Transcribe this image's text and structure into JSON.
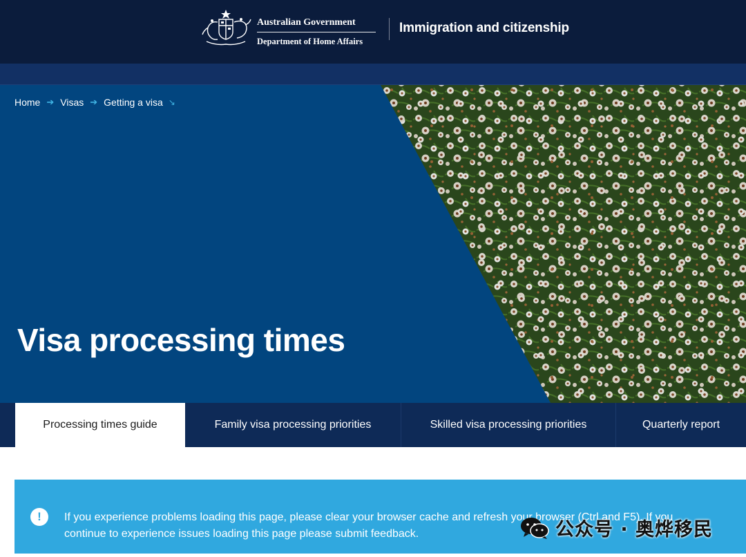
{
  "header": {
    "gov_name": "Australian Government",
    "department": "Department of Home Affairs",
    "site_title": "Immigration and citizenship"
  },
  "breadcrumb": {
    "items": [
      "Home",
      "Visas",
      "Getting a visa"
    ]
  },
  "hero": {
    "title": "Visa processing times"
  },
  "tabs": [
    {
      "label": "Processing times guide",
      "active": true
    },
    {
      "label": "Family visa processing priorities",
      "active": false
    },
    {
      "label": "Skilled visa processing priorities",
      "active": false
    },
    {
      "label": "Quarterly report",
      "active": false
    }
  ],
  "alert": {
    "text": "If you experience problems loading this page, please clear your browser cache and refresh your browser (Ctrl and F5). If you continue to experience issues loading this page please submit feedback."
  },
  "watermark": {
    "text": "公众号 · 奥烨移民"
  },
  "colors": {
    "header_bg": "#0b1c3c",
    "nav_bg": "#123064",
    "hero_bg": "#02457f",
    "tabs_bg": "#0e2a57",
    "accent": "#41b6e6",
    "alert_bg": "#30a8df"
  },
  "icons": {
    "crest": "coat-of-arms-icon",
    "breadcrumb_separator": "arrow-right-icon",
    "breadcrumb_expand": "arrow-down-right-icon",
    "alert": "exclamation-icon",
    "watermark": "wechat-icon"
  }
}
